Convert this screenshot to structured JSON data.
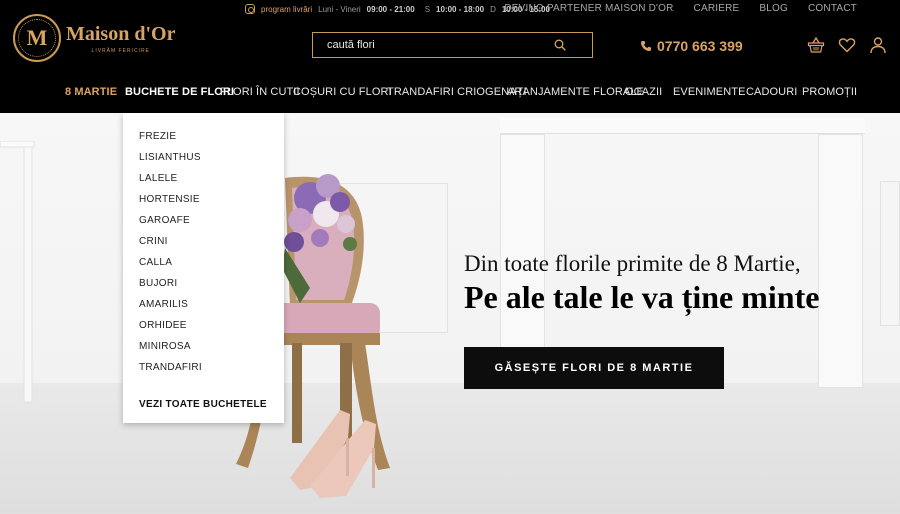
{
  "topbar": {
    "schedule_label": "program livrări",
    "weekdays_label": "Luni - Vineri",
    "weekdays_hours": "09:00 - 21:00",
    "saturday_prefix": "S",
    "saturday_hours": "10:00 - 18:00",
    "sunday_prefix": "D",
    "sunday_hours": "10:00 - 15:00",
    "links": [
      "DEVINO PARTENER MAISON D'OR",
      "CARIERE",
      "BLOG",
      "CONTACT"
    ]
  },
  "logo": {
    "monogram": "M",
    "name": "Maison d'Or",
    "tagline": "LIVRĂM FERICIRE"
  },
  "search": {
    "placeholder": "caută flori"
  },
  "phone": "0770 663 399",
  "nav": [
    {
      "label": "8 MARTIE"
    },
    {
      "label": "BUCHETE DE FLORI"
    },
    {
      "label": "FLORI ÎN CUTII"
    },
    {
      "label": "COȘURI CU FLORI"
    },
    {
      "label": "TRANDAFIRI CRIOGENAȚI"
    },
    {
      "label": "ARANJAMENTE FLORALE"
    },
    {
      "label": "OCAZII"
    },
    {
      "label": "EVENIMENTE"
    },
    {
      "label": "CADOURI"
    },
    {
      "label": "PROMOȚII"
    }
  ],
  "dropdown": {
    "items": [
      "FREZIE",
      "LISIANTHUS",
      "LALELE",
      "HORTENSIE",
      "GAROAFE",
      "CRINI",
      "CALLA",
      "BUJORI",
      "AMARILIS",
      "ORHIDEE",
      "MINIROSA",
      "TRANDAFIRI"
    ],
    "view_all": "VEZI TOATE BUCHETELE"
  },
  "hero": {
    "line1": "Din toate florile primite de 8 Martie,",
    "line2": "Pe ale tale le va ține minte",
    "cta": "GĂSEȘTE FLORI DE 8 MARTIE"
  },
  "colors": {
    "gold": "#d8a464",
    "header_bg": "#000000"
  }
}
